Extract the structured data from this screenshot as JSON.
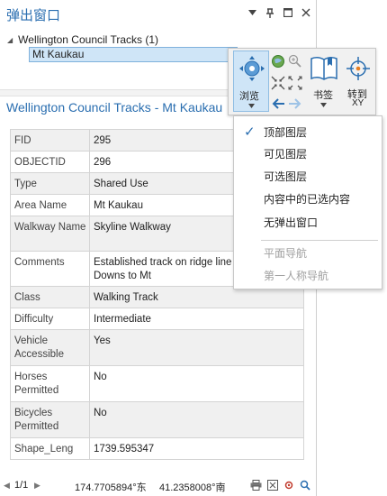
{
  "window": {
    "title": "弹出窗口",
    "controls": [
      "chevron-down-icon",
      "pin-icon",
      "maximize-icon",
      "close-icon"
    ]
  },
  "tree": {
    "layer": "Wellington Council Tracks (1)",
    "feature": "Mt Kaukau"
  },
  "popup": {
    "title": "Wellington Council Tracks - Mt Kaukau",
    "rows": [
      {
        "key": "FID",
        "value": "295"
      },
      {
        "key": "OBJECTID",
        "value": "296"
      },
      {
        "key": "Type",
        "value": "Shared Use"
      },
      {
        "key": "Area Name",
        "value": "Mt Kaukau"
      },
      {
        "key": "Walkway Name",
        "value": "Skyline Walkway"
      },
      {
        "key": "Comments",
        "value": "Established track on ridge line Drive, Crofton Downs to Mt"
      },
      {
        "key": "Class",
        "value": "Walking Track"
      },
      {
        "key": "Difficulty",
        "value": "Intermediate"
      },
      {
        "key": "Vehicle Accessible",
        "value": "Yes"
      },
      {
        "key": "Horses Permitted",
        "value": "No"
      },
      {
        "key": "Bicycles Permitted",
        "value": "No"
      },
      {
        "key": "Shape_Leng",
        "value": "1739.595347"
      }
    ]
  },
  "status": {
    "page": "1/1",
    "x": "174.7705894°东",
    "y": "41.2358008°南"
  },
  "ribbon": {
    "explore_label": "浏览",
    "bookmarks_label": "书签",
    "goto_label_line1": "转到",
    "goto_label_line2": "XY"
  },
  "menu": {
    "items": [
      {
        "label": "顶部图层",
        "checked": true,
        "enabled": true
      },
      {
        "label": "可见图层",
        "checked": false,
        "enabled": true
      },
      {
        "label": "可选图层",
        "checked": false,
        "enabled": true
      },
      {
        "label": "内容中的已选内容",
        "checked": false,
        "enabled": true
      },
      {
        "label": "无弹出窗口",
        "checked": false,
        "enabled": true
      },
      {
        "label": "平面导航",
        "checked": false,
        "enabled": false
      },
      {
        "label": "第一人称导航",
        "checked": false,
        "enabled": false
      }
    ]
  },
  "colors": {
    "accent": "#2a6eb0",
    "selection": "#cfe5f7",
    "row_alt": "#f0f0f0"
  }
}
